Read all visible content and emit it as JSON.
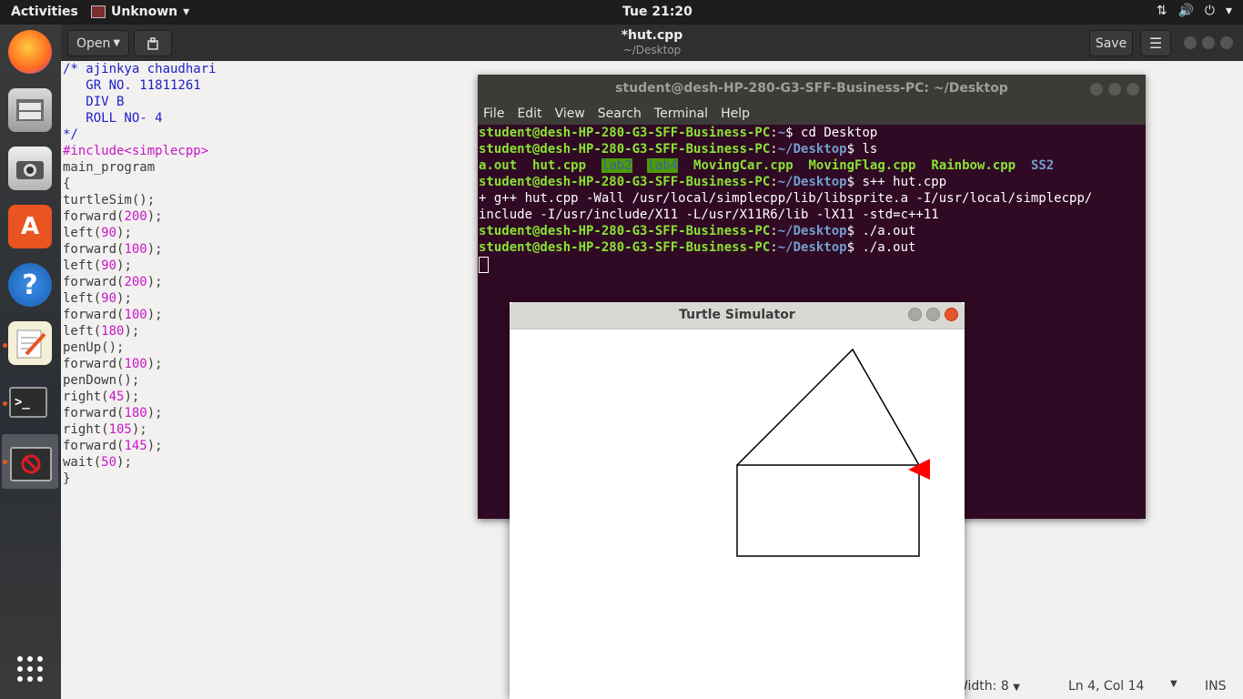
{
  "top_panel": {
    "activities": "Activities",
    "app_menu": "Unknown",
    "clock": "Tue 21:20"
  },
  "gedit": {
    "open_label": "Open",
    "title": "*hut.cpp",
    "subtitle": "~/Desktop",
    "save_label": "Save",
    "code": [
      {
        "parts": [
          {
            "t": "/* ajinkya chaudhari",
            "c": "cmt"
          }
        ]
      },
      {
        "parts": [
          {
            "t": "   GR NO. 11811261",
            "c": "cmt"
          }
        ]
      },
      {
        "parts": [
          {
            "t": "   DIV B",
            "c": "cmt"
          }
        ]
      },
      {
        "parts": [
          {
            "t": "   ROLL NO- 4",
            "c": "cmt"
          }
        ]
      },
      {
        "parts": [
          {
            "t": "*/",
            "c": "cmt"
          }
        ]
      },
      {
        "parts": [
          {
            "t": "#include<simplecpp>",
            "c": "pp"
          }
        ]
      },
      {
        "parts": [
          {
            "t": "main_program",
            "c": ""
          }
        ]
      },
      {
        "parts": [
          {
            "t": "{",
            "c": ""
          }
        ]
      },
      {
        "parts": [
          {
            "t": "turtleSim();",
            "c": ""
          }
        ]
      },
      {
        "parts": [
          {
            "t": "forward(",
            "c": ""
          },
          {
            "t": "200",
            "c": "num"
          },
          {
            "t": ");",
            "c": ""
          }
        ]
      },
      {
        "parts": [
          {
            "t": "left(",
            "c": ""
          },
          {
            "t": "90",
            "c": "num"
          },
          {
            "t": ");",
            "c": ""
          }
        ]
      },
      {
        "parts": [
          {
            "t": "forward(",
            "c": ""
          },
          {
            "t": "100",
            "c": "num"
          },
          {
            "t": ");",
            "c": ""
          }
        ]
      },
      {
        "parts": [
          {
            "t": "left(",
            "c": ""
          },
          {
            "t": "90",
            "c": "num"
          },
          {
            "t": ");",
            "c": ""
          }
        ]
      },
      {
        "parts": [
          {
            "t": "forward(",
            "c": ""
          },
          {
            "t": "200",
            "c": "num"
          },
          {
            "t": ");",
            "c": ""
          }
        ]
      },
      {
        "parts": [
          {
            "t": "left(",
            "c": ""
          },
          {
            "t": "90",
            "c": "num"
          },
          {
            "t": ");",
            "c": ""
          }
        ]
      },
      {
        "parts": [
          {
            "t": "forward(",
            "c": ""
          },
          {
            "t": "100",
            "c": "num"
          },
          {
            "t": ");",
            "c": ""
          }
        ]
      },
      {
        "parts": [
          {
            "t": "left(",
            "c": ""
          },
          {
            "t": "180",
            "c": "num"
          },
          {
            "t": ");",
            "c": ""
          }
        ]
      },
      {
        "parts": [
          {
            "t": "penUp();",
            "c": ""
          }
        ]
      },
      {
        "parts": [
          {
            "t": "forward(",
            "c": ""
          },
          {
            "t": "100",
            "c": "num"
          },
          {
            "t": ");",
            "c": ""
          }
        ]
      },
      {
        "parts": [
          {
            "t": "penDown();",
            "c": ""
          }
        ]
      },
      {
        "parts": [
          {
            "t": "right(",
            "c": ""
          },
          {
            "t": "45",
            "c": "num"
          },
          {
            "t": ");",
            "c": ""
          }
        ]
      },
      {
        "parts": [
          {
            "t": "forward(",
            "c": ""
          },
          {
            "t": "180",
            "c": "num"
          },
          {
            "t": ");",
            "c": ""
          }
        ]
      },
      {
        "parts": [
          {
            "t": "right(",
            "c": ""
          },
          {
            "t": "105",
            "c": "num"
          },
          {
            "t": ");",
            "c": ""
          }
        ]
      },
      {
        "parts": [
          {
            "t": "forward(",
            "c": ""
          },
          {
            "t": "145",
            "c": "num"
          },
          {
            "t": ");",
            "c": ""
          }
        ]
      },
      {
        "parts": [
          {
            "t": "wait(",
            "c": ""
          },
          {
            "t": "50",
            "c": "num"
          },
          {
            "t": ");",
            "c": ""
          }
        ]
      },
      {
        "parts": [
          {
            "t": "}",
            "c": ""
          }
        ]
      }
    ],
    "status": {
      "tab_width": "Width: 8",
      "position": "Ln 4, Col 14",
      "mode": "INS"
    }
  },
  "terminal": {
    "title": "student@desh-HP-280-G3-SFF-Business-PC: ~/Desktop",
    "menu": [
      "File",
      "Edit",
      "View",
      "Search",
      "Terminal",
      "Help"
    ],
    "lines": [
      [
        {
          "t": "student@desh-HP-280-G3-SFF-Business-PC",
          "c": "tg"
        },
        {
          "t": ":",
          "c": ""
        },
        {
          "t": "~",
          "c": "tb"
        },
        {
          "t": "$ cd Desktop",
          "c": ""
        }
      ],
      [
        {
          "t": "student@desh-HP-280-G3-SFF-Business-PC",
          "c": "tg"
        },
        {
          "t": ":",
          "c": ""
        },
        {
          "t": "~/Desktop",
          "c": "tb"
        },
        {
          "t": "$ ls",
          "c": ""
        }
      ],
      [
        {
          "t": "a.out",
          "c": "tg"
        },
        {
          "t": "  ",
          "c": ""
        },
        {
          "t": "hut.cpp",
          "c": "tg"
        },
        {
          "t": "  ",
          "c": ""
        },
        {
          "t": "lab2",
          "c": "tdir"
        },
        {
          "t": "  ",
          "c": ""
        },
        {
          "t": "lab4",
          "c": "tdir"
        },
        {
          "t": "  ",
          "c": ""
        },
        {
          "t": "MovingCar.cpp",
          "c": "tg"
        },
        {
          "t": "  ",
          "c": ""
        },
        {
          "t": "MovingFlag.cpp",
          "c": "tg"
        },
        {
          "t": "  ",
          "c": ""
        },
        {
          "t": "Rainbow.cpp",
          "c": "tg"
        },
        {
          "t": "  ",
          "c": ""
        },
        {
          "t": "SS2",
          "c": "tb"
        }
      ],
      [
        {
          "t": "student@desh-HP-280-G3-SFF-Business-PC",
          "c": "tg"
        },
        {
          "t": ":",
          "c": ""
        },
        {
          "t": "~/Desktop",
          "c": "tb"
        },
        {
          "t": "$ s++ hut.cpp",
          "c": ""
        }
      ],
      [
        {
          "t": "+ g++ hut.cpp -Wall /usr/local/simplecpp/lib/libsprite.a -I/usr/local/simplecpp/",
          "c": ""
        }
      ],
      [
        {
          "t": "include -I/usr/include/X11 -L/usr/X11R6/lib -lX11 -std=c++11",
          "c": ""
        }
      ],
      [
        {
          "t": "student@desh-HP-280-G3-SFF-Business-PC",
          "c": "tg"
        },
        {
          "t": ":",
          "c": ""
        },
        {
          "t": "~/Desktop",
          "c": "tb"
        },
        {
          "t": "$ ./a.out",
          "c": ""
        }
      ],
      [
        {
          "t": "student@desh-HP-280-G3-SFF-Business-PC",
          "c": "tg"
        },
        {
          "t": ":",
          "c": ""
        },
        {
          "t": "~/Desktop",
          "c": "tb"
        },
        {
          "t": "$ ./a.out",
          "c": ""
        }
      ]
    ]
  },
  "turtle_window": {
    "title": "Turtle Simulator",
    "turtle_color": "#ff0000"
  },
  "colors": {
    "terminal_bg": "#300a24",
    "prompt_green": "#8ae234",
    "path_blue": "#729fcf",
    "comment_blue": "#1e20c8",
    "literal_magenta": "#c817c8"
  }
}
